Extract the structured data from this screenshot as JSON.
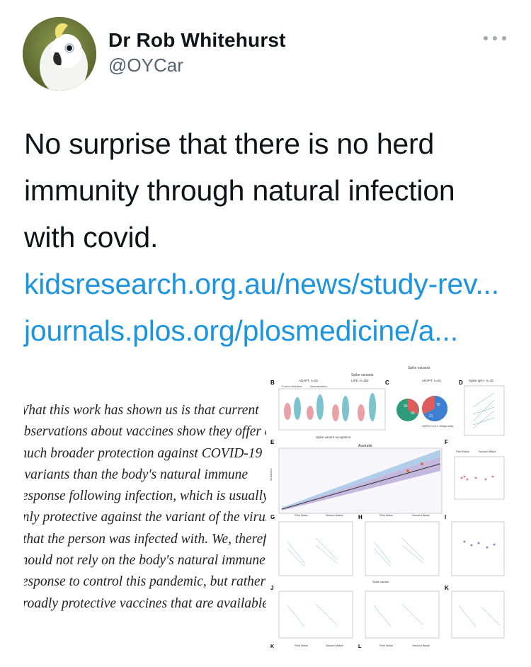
{
  "user": {
    "display_name": "Dr Rob Whitehurst",
    "handle": "@OYCar"
  },
  "tweet": {
    "lines": [
      "No surprise that there is no herd",
      "immunity through natural infection",
      "with covid."
    ],
    "links": [
      "kidsresearch.org.au/news/study-rev...",
      "journals.plos.org/plosmedicine/a..."
    ]
  },
  "media": {
    "quote_lines": [
      "What this work has shown us is that current",
      "observations about vaccines show they offer a",
      "much broader protection against COVID-19",
      "s variants than the body's natural immune",
      "response following infection, which is usually",
      "only protective against the variant of the virus",
      "that the person was infected with. We, therefore",
      "should not rely on the body's natural immune",
      "response to control this pandemic, but rather",
      "broadly protective vaccines that are available"
    ],
    "figure": {
      "panel_labels": [
        "B",
        "C",
        "D",
        "E",
        "F",
        "G",
        "H",
        "I",
        "J",
        "K",
        "L"
      ],
      "top_axis_label": "Spike variants",
      "panel_b_title_1": "ADAPT, n=81",
      "panel_b_title_2": "LIFE, n=152",
      "panel_b_sub_1": "Fusion inhibition",
      "panel_b_sub_2": "Neutralization",
      "panel_b_xlabel": "Spike variant recognition",
      "panel_c_title": "ADAPT, n=81",
      "panel_c_caption": "SARS-CoV-2 antigenicity",
      "panel_d_title": "Spike IgG+, n=30",
      "panel_e_title": "Australia",
      "panel_e_ylabel": "Mutations",
      "wave_first": "First Wave",
      "wave_second": "Second Wave",
      "spike_variant": "Spike variant",
      "pie_values": [
        "70",
        "21",
        "35",
        "29"
      ]
    }
  }
}
